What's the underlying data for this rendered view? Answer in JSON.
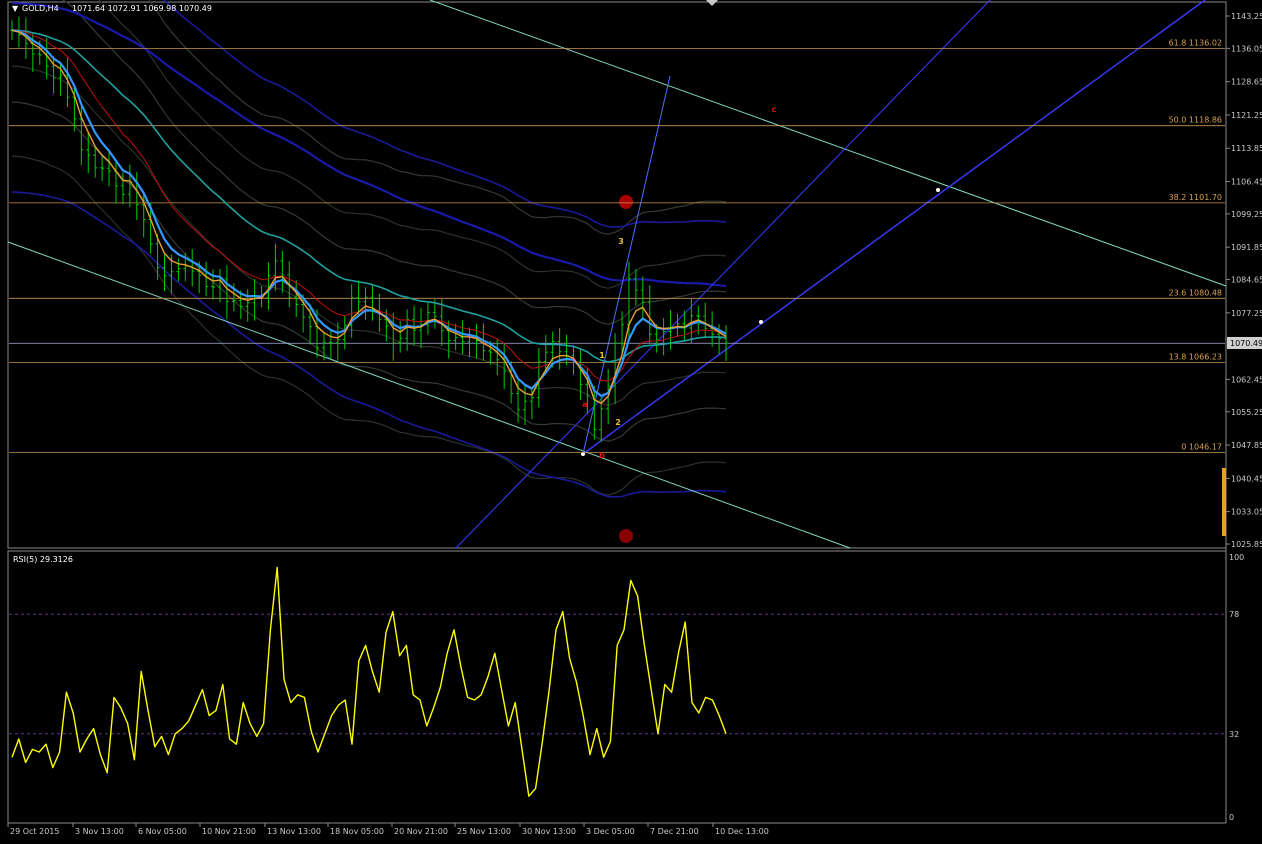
{
  "header": {
    "symbol_text": "GOLD,H4",
    "ohlc_text": "1071.64 1072.91 1069.98 1070.49"
  },
  "current_price_label": "1070.49",
  "rsi_header": "RSI(5) 29.3126",
  "colors": {
    "background": "#000000",
    "candles": "#00cc00",
    "fib": "#c8964c",
    "rsi": "#ffff00",
    "channel": "#3a3aff",
    "teal_line": "#7fd9c4"
  },
  "chart_data": [
    {
      "type": "line",
      "panel": "price",
      "symbol": "GOLD",
      "timeframe": "H4",
      "y_axis_ticks": [
        "1143.25",
        "1136.05",
        "1128.65",
        "1121.25",
        "1113.85",
        "1106.45",
        "1099.25",
        "1091.85",
        "1084.65",
        "1077.25",
        "1062.45",
        "1055.25",
        "1047.85",
        "1040.45",
        "1033.05",
        "1025.85"
      ],
      "ylim": [
        1025.85,
        1143.25
      ],
      "x_axis_ticks": [
        "29 Oct 2015",
        "3 Nov 13:00",
        "6 Nov 05:00",
        "10 Nov 21:00",
        "13 Nov 13:00",
        "18 Nov 05:00",
        "20 Nov 21:00",
        "25 Nov 13:00",
        "30 Nov 13:00",
        "3 Dec 05:00",
        "7 Dec 21:00",
        "10 Dec 13:00"
      ],
      "fib_levels": [
        {
          "label": "61.8 1136.02",
          "value": 1136.02
        },
        {
          "label": "50.0 1118.86",
          "value": 1118.86
        },
        {
          "label": "38.2 1101.70",
          "value": 1101.7
        },
        {
          "label": "23.6 1080.48",
          "value": 1080.48
        },
        {
          "label": "13.8 1066.23",
          "value": 1066.23
        },
        {
          "label": "0 1046.17",
          "value": 1046.17
        }
      ],
      "current_price": 1070.49,
      "wave_labels": [
        {
          "text": "1",
          "color": "#e8c030"
        },
        {
          "text": "2",
          "color": "#e8c030"
        },
        {
          "text": "3",
          "color": "#e8c030"
        },
        {
          "text": "a",
          "color": "#dd1111"
        },
        {
          "text": "b",
          "color": "#dd1111"
        },
        {
          "text": "c",
          "color": "#dd1111"
        }
      ],
      "series": [
        {
          "name": "GOLD,H4 close",
          "color": "#00cc00",
          "values": [
            1140.1,
            1139.1,
            1137.1,
            1134.8,
            1134.6,
            1132.1,
            1129.5,
            1130.1,
            1125.2,
            1120.4,
            1113.5,
            1112.3,
            1109.5,
            1109.4,
            1108.8,
            1105.5,
            1103.6,
            1106.4,
            1101.3,
            1098.0,
            1092.6,
            1087.3,
            1085.5,
            1086.4,
            1087.1,
            1087.6,
            1086.5,
            1085.6,
            1083.1,
            1083.0,
            1084.8,
            1079.8,
            1080.0,
            1078.7,
            1079.5,
            1081.0,
            1080.7,
            1085.5,
            1088.8,
            1085.7,
            1080.7,
            1079.1,
            1076.3,
            1074.2,
            1069.5,
            1070.7,
            1070.6,
            1071.3,
            1074.5,
            1080.6,
            1079.7,
            1080.7,
            1077.7,
            1075.8,
            1074.3,
            1070.6,
            1071.6,
            1075.8,
            1073.4,
            1074.6,
            1077.3,
            1076.5,
            1073.3,
            1071.1,
            1071.8,
            1070.8,
            1071.8,
            1071.1,
            1068.8,
            1068.5,
            1066.8,
            1064.3,
            1059.3,
            1055.7,
            1057.6,
            1058.4,
            1066.4,
            1068.5,
            1070.9,
            1068.6,
            1067.8,
            1066.3,
            1061.3,
            1058.8,
            1051.3,
            1055.9,
            1061.0,
            1070.5,
            1074.6,
            1084.8,
            1082.3,
            1079.6,
            1072.5,
            1071.2,
            1073.1,
            1074.1,
            1074.8,
            1073.9,
            1076.6,
            1076.5,
            1073.8,
            1072.5,
            1071.5,
            1070.5
          ]
        },
        {
          "name": "RSI(5)",
          "color": "#ffff00",
          "ylim": [
            0,
            100
          ],
          "ticks": [
            "100",
            "78",
            "32",
            "0"
          ],
          "values": [
            23,
            30,
            21,
            26,
            25,
            28,
            19,
            25,
            48,
            40,
            25,
            30,
            34,
            24,
            17,
            46,
            42,
            36,
            22,
            56,
            41,
            27,
            31,
            24,
            32,
            34,
            37,
            43,
            49,
            39,
            41,
            51,
            30,
            28,
            44,
            36,
            31,
            36,
            72,
            96,
            53,
            44,
            47,
            46,
            33,
            25,
            32,
            39,
            43,
            45,
            28,
            60,
            66,
            56,
            48,
            71,
            79,
            62,
            66,
            47,
            45,
            35,
            42,
            50,
            63,
            72,
            58,
            46,
            45,
            47,
            54,
            63,
            49,
            35,
            44,
            26,
            8,
            11,
            29,
            49,
            72,
            79,
            61,
            52,
            39,
            24,
            34,
            23,
            29,
            66,
            72,
            91,
            85,
            66,
            49,
            32,
            51,
            48,
            63,
            75,
            44,
            40,
            46,
            45,
            39,
            32
          ]
        }
      ]
    }
  ]
}
